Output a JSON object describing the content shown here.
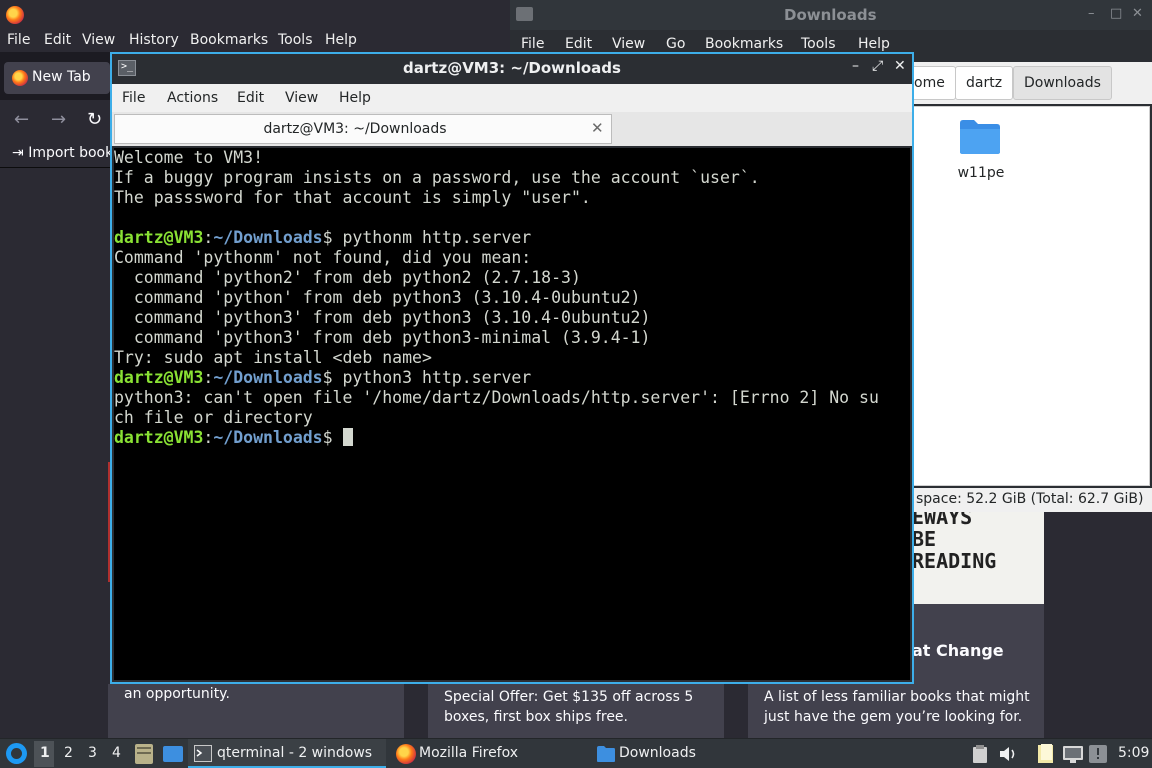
{
  "firefox": {
    "menu": [
      "File",
      "Edit",
      "View",
      "History",
      "Bookmarks",
      "Tools",
      "Help"
    ],
    "tab_label": "New Tab",
    "nav_icons": [
      "back-icon",
      "forward-icon",
      "reload-icon"
    ],
    "import_bookmarks": "Import book",
    "cards": {
      "left_text": "an opportunity.",
      "middle_text": "Special Offer: Get $135 off across 5\nboxes, first box ships free.",
      "right_heading": "at Change",
      "right_text": "A list of less familiar books that might\njust have the gem you’re looking for.",
      "image_text": "EWAYS\nBE\nREADING"
    }
  },
  "file_manager": {
    "title": "Downloads",
    "controls": [
      "–",
      "□",
      "✕"
    ],
    "menu": [
      "File",
      "Edit",
      "View",
      "Go",
      "Bookmarks",
      "Tools",
      "Help"
    ],
    "breadcrumbs": [
      "ome",
      "dartz",
      "Downloads"
    ],
    "files": [
      {
        "name": "w11pe",
        "icon": "folder-icon"
      }
    ],
    "status": "space: 52.2 GiB (Total: 62.7 GiB)"
  },
  "terminal": {
    "title": "dartz@VM3: ~/Downloads",
    "controls": [
      "–",
      "⤢",
      "✕"
    ],
    "menu": [
      "File",
      "Actions",
      "Edit",
      "View",
      "Help"
    ],
    "tab_label": "dartz@VM3: ~/Downloads",
    "tab_close": "✕",
    "prompt_user": "dartz@VM3",
    "prompt_path": "~/Downloads",
    "lines": {
      "l1": "Welcome to VM3!",
      "l2": "If a buggy program insists on a password, use the account `user`.",
      "l3": "The passsword for that account is simply \"user\".",
      "l4": "",
      "cmd1": " pythonm http.server",
      "l6": "Command 'pythonm' not found, did you mean:",
      "l7": "  command 'python2' from deb python2 (2.7.18-3)",
      "l8": "  command 'python' from deb python3 (3.10.4-0ubuntu2)",
      "l9": "  command 'python3' from deb python3 (3.10.4-0ubuntu2)",
      "l10": "  command 'python3' from deb python3-minimal (3.9.4-1)",
      "l11": "Try: sudo apt install <deb name>",
      "cmd2": " python3 http.server",
      "l13": "python3: can't open file '/home/dartz/Downloads/http.server': [Errno 2] No su",
      "l14": "ch file or directory"
    }
  },
  "taskbar": {
    "workspaces": [
      "1",
      "2",
      "3",
      "4"
    ],
    "active_workspace": "1",
    "tasks": [
      "qterminal - 2 windows",
      "Mozilla Firefox",
      "Downloads"
    ],
    "clock": "5:09"
  },
  "colors": {
    "accent": "#3daee9",
    "prompt_user": "#8ae234",
    "prompt_path": "#729fcf"
  }
}
